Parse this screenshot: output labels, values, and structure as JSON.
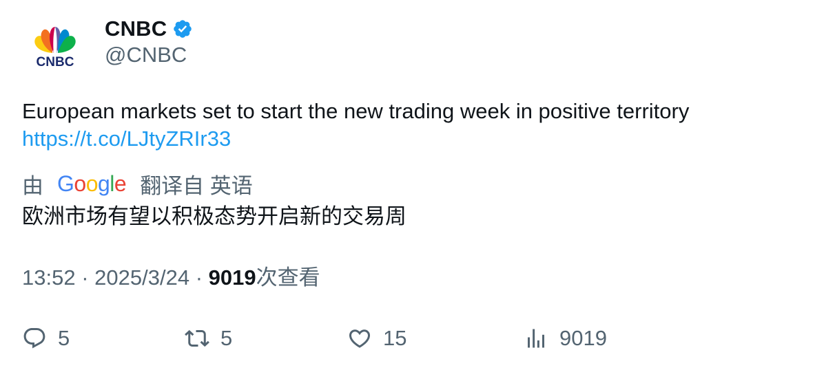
{
  "author": {
    "display_name": "CNBC",
    "handle": "@CNBC",
    "verified": true,
    "avatar_logo_text": "CNBC"
  },
  "tweet": {
    "text": "European markets set to start the new trading week in positive territory",
    "link": "https://t.co/LJtyZRIr33"
  },
  "translation": {
    "prefix": "由",
    "provider": "Google",
    "suffix": "翻译自 英语",
    "text": "欧洲市场有望以积极态势开启新的交易周"
  },
  "meta": {
    "time": "13:52",
    "separator": "·",
    "date": "2025/3/24",
    "views_count": "9019",
    "views_label": "次查看"
  },
  "actions": {
    "replies": "5",
    "retweets": "5",
    "likes": "15",
    "views": "9019"
  },
  "colors": {
    "link": "#1d9bf0",
    "verified_badge": "#1d9bf0",
    "secondary_text": "#536471",
    "primary_text": "#0f1419"
  },
  "icons": {
    "reply": "reply-icon",
    "retweet": "retweet-icon",
    "like": "heart-icon",
    "views": "analytics-icon",
    "verified": "verified-badge-icon"
  }
}
